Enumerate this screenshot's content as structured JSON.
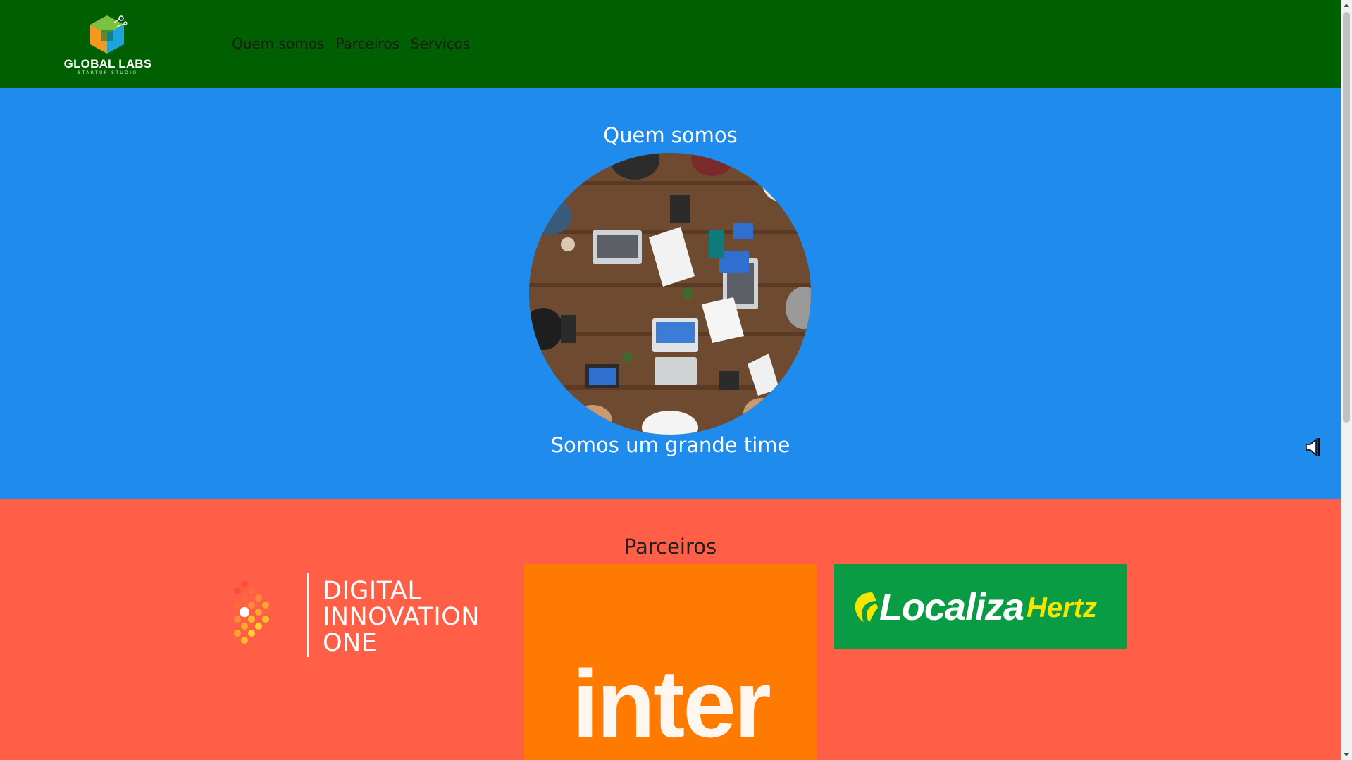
{
  "header": {
    "logo": {
      "name": "GLOBAL LABS",
      "tagline": "STARTUP STUDIO"
    },
    "nav": [
      {
        "label": "Quem somos"
      },
      {
        "label": "Parceiros"
      },
      {
        "label": "Serviços"
      }
    ],
    "background_color": "#005f00"
  },
  "about": {
    "title": "Quem somos",
    "image": "team-meeting-photo",
    "caption": "Somos um grande time",
    "background_color": "#1e8bed",
    "audio_icon": "speaker-icon"
  },
  "partners": {
    "title": "Parceiros",
    "background_color": "#ff5f46",
    "items": [
      {
        "name": "DIGITAL INNOVATION ONE",
        "lines": [
          "DIGITAL",
          "INNOVATION",
          "ONE"
        ]
      },
      {
        "name": "inter",
        "color": "#ff7a00"
      },
      {
        "name": "Localiza Hertz",
        "primary": "Localiza",
        "secondary": "Hertz",
        "color": "#0a9b45"
      }
    ]
  }
}
